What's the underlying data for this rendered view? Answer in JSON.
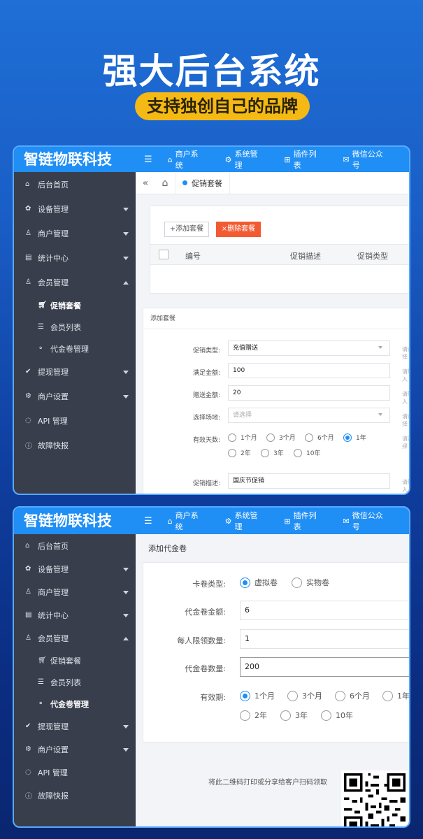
{
  "hero": {
    "title": "强大后台系统",
    "subtitle": "支持独创自己的品牌"
  },
  "brand": "智链物联科技",
  "topnav": [
    {
      "icon": "home-icon",
      "label": "商户系统"
    },
    {
      "icon": "gear-icon",
      "label": "系统管理"
    },
    {
      "icon": "plugin-icon",
      "label": "插件列表"
    },
    {
      "icon": "wechat-icon",
      "label": "微信公众号"
    }
  ],
  "sidebar": {
    "items": [
      {
        "label": "后台首页"
      },
      {
        "label": "设备管理"
      },
      {
        "label": "商户管理"
      },
      {
        "label": "统计中心"
      },
      {
        "label": "会员管理"
      },
      {
        "label": "促销套餐"
      },
      {
        "label": "会员列表"
      },
      {
        "label": "代金卷管理"
      },
      {
        "label": "提现管理"
      },
      {
        "label": "商户设置"
      },
      {
        "label": "API 管理"
      },
      {
        "label": "故障快报"
      }
    ]
  },
  "panel1": {
    "tab_label": "促销套餐",
    "add_button": "+添加套餐",
    "delete_button": "×删除套餐",
    "columns": [
      "编号",
      "促销描述",
      "促销类型"
    ],
    "form_title": "添加套餐",
    "fields": {
      "type": {
        "label": "促销类型:",
        "value": "充值赠送",
        "hint": "请选择"
      },
      "amount": {
        "label": "满足金额:",
        "value": "100",
        "hint": "请输入"
      },
      "bonus": {
        "label": "赠送金额:",
        "value": "20",
        "hint": "请输入"
      },
      "site": {
        "label": "选择场地:",
        "placeholder": "请选择",
        "hint": "请选择"
      },
      "days": {
        "label": "有效天数:",
        "options": [
          "1个月",
          "3个月",
          "6个月",
          "1年",
          "2年",
          "3年",
          "10年"
        ],
        "selected": "1年",
        "hint": "请选择"
      },
      "desc": {
        "label": "促销描述:",
        "value": "国庆节促销",
        "hint": "请输入"
      }
    }
  },
  "panel2": {
    "header": "添加代金卷",
    "fields": {
      "card_type": {
        "label": "卡卷类型:",
        "options": [
          "虚拟卷",
          "实物卷"
        ],
        "selected": "虚拟卷"
      },
      "amount": {
        "label": "代金卷金额:",
        "value": "6"
      },
      "limit": {
        "label": "每人限领数量:",
        "value": "1"
      },
      "count": {
        "label": "代金卷数量:",
        "value": "200"
      },
      "period": {
        "label": "有效期:",
        "options": [
          "1个月",
          "3个月",
          "6个月",
          "1年",
          "2年",
          "3年",
          "10年"
        ],
        "selected": "1个月"
      }
    },
    "qr_text": "将此二维码打印或分享给客户扫码领取"
  },
  "colors": {
    "accent": "#1f8ef5",
    "sidebar": "#393e4c",
    "danger": "#f25a32",
    "badge": "#f5b915"
  }
}
